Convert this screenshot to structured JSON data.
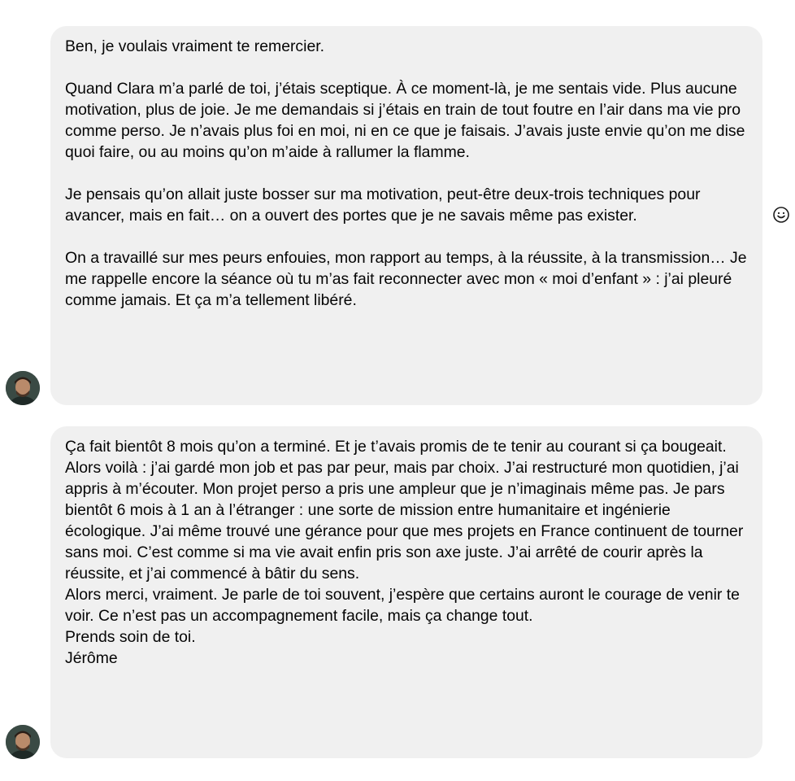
{
  "conversation": {
    "messages": [
      {
        "paragraphs": [
          "Ben, je voulais vraiment te remercier.",
          "Quand Clara m’a parlé de toi, j’étais sceptique. À ce moment-là, je me sentais vide. Plus aucune motivation, plus de joie. Je me demandais si j’étais en train de tout foutre en l’air dans ma vie pro comme perso. Je n’avais plus foi en moi, ni en ce que je faisais. J’avais juste envie qu’on me dise quoi faire, ou au moins qu’on m’aide à rallumer la flamme.",
          "Je pensais qu’on allait juste bosser sur ma motivation, peut-être deux-trois techniques pour avancer, mais en fait… on a ouvert des portes que je ne savais même pas exister.",
          "On a travaillé sur mes peurs enfouies, mon rapport au temps, à la réussite, à la transmission… Je me rappelle encore la séance où tu m’as fait reconnecter avec mon « moi d’enfant » : j’ai pleuré comme jamais. Et ça m’a tellement libéré."
        ]
      },
      {
        "lines": [
          "Ça fait bientôt 8 mois qu’on a terminé. Et je t’avais promis de te tenir au courant si ça bougeait. Alors voilà : j’ai gardé mon job et pas par peur, mais par choix. J’ai restructuré mon quotidien, j’ai appris à m’écouter. Mon projet perso a pris une ampleur que je n’imaginais même pas. Je pars bientôt 6 mois à 1 an à l’étranger : une sorte de mission entre humanitaire et ingénierie écologique. J’ai même trouvé une gérance pour que mes projets en France continuent de tourner sans moi. C’est comme si ma vie avait enfin pris son axe juste. J’ai arrêté de courir après la réussite, et j’ai commencé à bâtir du sens.",
          "Alors merci, vraiment. Je parle de toi souvent, j’espère que certains auront le courage de venir te voir. Ce n’est pas un accompagnement facile, mais ça change tout.",
          "Prends soin de toi.",
          "Jérôme"
        ]
      }
    ],
    "icons": {
      "react": "smiley-icon",
      "avatar": "avatar"
    }
  }
}
